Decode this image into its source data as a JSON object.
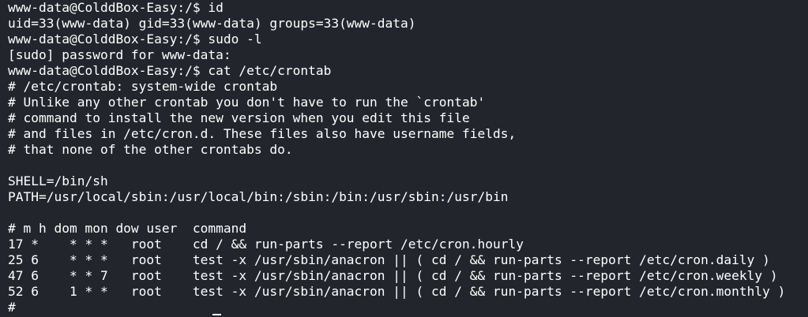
{
  "terminal": {
    "lines": [
      "www-data@ColddBox-Easy:/$ id",
      "uid=33(www-data) gid=33(www-data) groups=33(www-data)",
      "www-data@ColddBox-Easy:/$ sudo -l",
      "[sudo] password for www-data:",
      "www-data@ColddBox-Easy:/$ cat /etc/crontab",
      "# /etc/crontab: system-wide crontab",
      "# Unlike any other crontab you don't have to run the `crontab'",
      "# command to install the new version when you edit this file",
      "# and files in /etc/cron.d. These files also have username fields,",
      "# that none of the other crontabs do.",
      "",
      "SHELL=/bin/sh",
      "PATH=/usr/local/sbin:/usr/local/bin:/sbin:/bin:/usr/sbin:/usr/bin",
      "",
      "# m h dom mon dow user  command",
      "17 *    * * *   root    cd / && run-parts --report /etc/cron.hourly",
      "25 6    * * *   root    test -x /usr/sbin/anacron || ( cd / && run-parts --report /etc/cron.daily )",
      "47 6    * * 7   root    test -x /usr/sbin/anacron || ( cd / && run-parts --report /etc/cron.weekly )",
      "52 6    1 * *   root    test -x /usr/sbin/anacron || ( cd / && run-parts --report /etc/cron.monthly )",
      "#"
    ]
  }
}
